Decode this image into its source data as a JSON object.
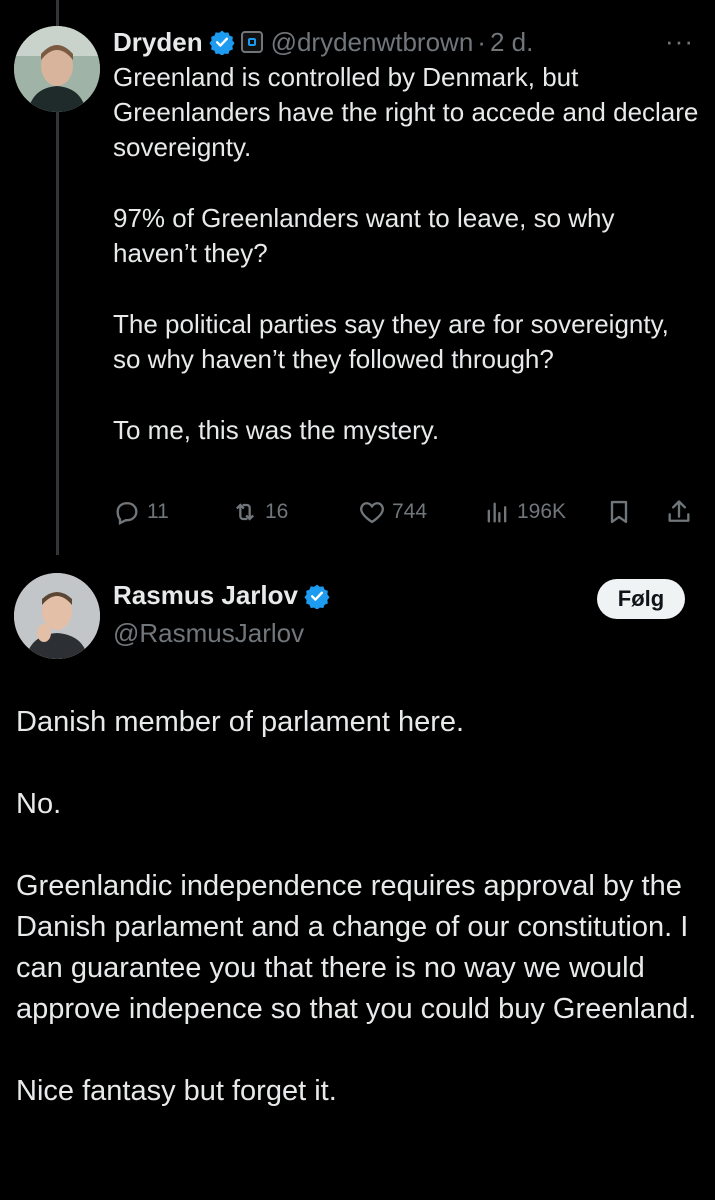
{
  "tweet1": {
    "name": "Dryden",
    "handle": "@drydenwtbrown",
    "separator": "·",
    "time": "2 d.",
    "more": "···",
    "paragraphs": [
      "Greenland is controlled by Denmark, but Greenlanders have the right to accede and declare sovereignty.",
      "97% of Greenlanders want to leave, so why haven’t they?",
      "The political parties say they are for sovereignty, so why haven’t they followed through?",
      "To me, this was the mystery."
    ],
    "replies": "11",
    "reposts": "16",
    "likes": "744",
    "views": "196K"
  },
  "tweet2": {
    "name": "Rasmus Jarlov",
    "handle": "@RasmusJarlov",
    "follow_label": "Følg",
    "paragraphs": [
      "Danish member of parlament here.",
      "No.",
      "Greenlandic independence requires approval by the Danish parlament and a change of our constitution. I can guarantee you that there is no way we would approve indepence so that you could buy Greenland.",
      "Nice fantasy but forget it."
    ]
  },
  "colors": {
    "background": "#000000",
    "text": "#e7e9ea",
    "muted": "#71767b",
    "verified": "#1d9bf0",
    "follow_bg": "#eff3f4"
  }
}
